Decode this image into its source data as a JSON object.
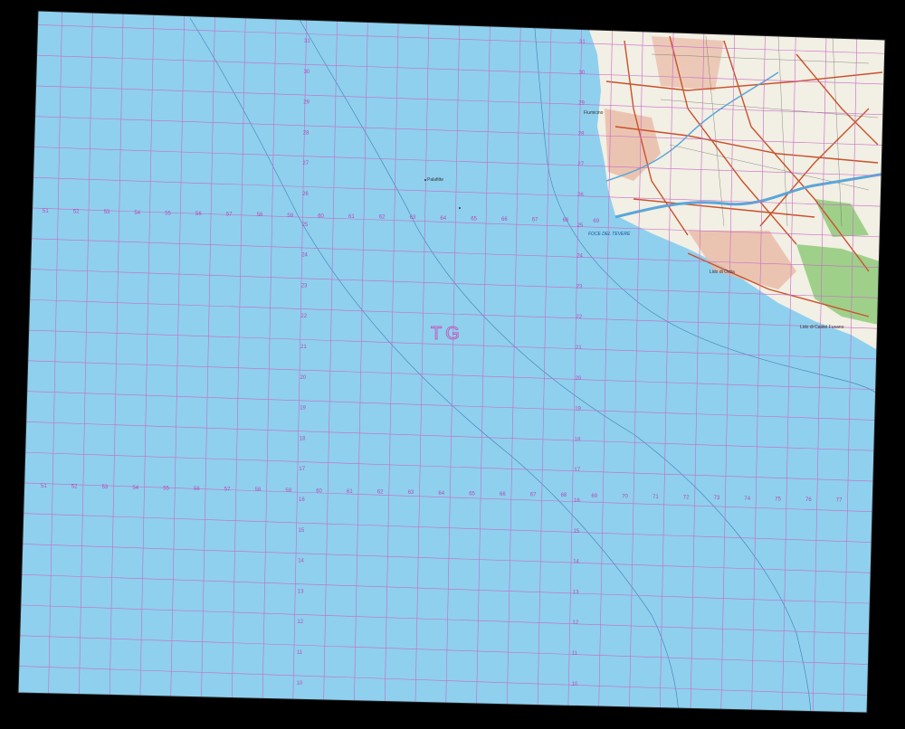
{
  "map": {
    "zone_label": "TG",
    "easting_labels": [
      "51",
      "52",
      "53",
      "54",
      "55",
      "56",
      "57",
      "58",
      "59",
      "60",
      "61",
      "62",
      "63",
      "64",
      "65",
      "66",
      "67",
      "68",
      "69",
      "70",
      "71",
      "72",
      "73",
      "74",
      "75",
      "76",
      "77"
    ],
    "northing_labels_col1": [
      "31",
      "30",
      "29",
      "28",
      "27",
      "26",
      "25",
      "24",
      "23",
      "22",
      "21",
      "20",
      "19",
      "18",
      "17",
      "16",
      "15",
      "14",
      "13",
      "12",
      "11",
      "10"
    ],
    "places": {
      "fiumicino": "Fiumicino",
      "foce_del_tevere": "FOCE DEL TEVERE",
      "lido_di_ostia": "Lido di Ostia",
      "lido_castel_fusano": "Lido di Castel Fusano",
      "palafitte": "Palafitte"
    },
    "colors": {
      "sea": "#8fd0ee",
      "grid": "#c86ac8",
      "land": "#f2efe4",
      "roads": "#c9512a",
      "forest": "#9fd08a",
      "border": "#000000"
    }
  }
}
